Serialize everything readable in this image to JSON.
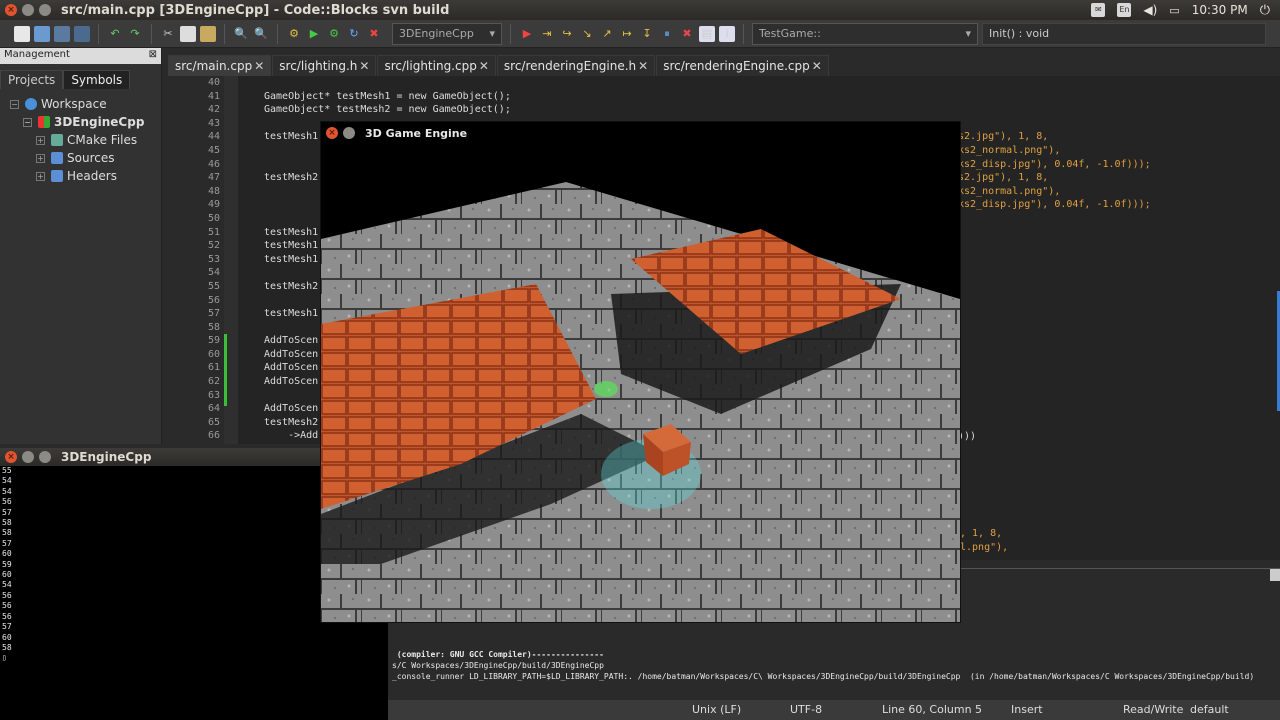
{
  "window": {
    "title": "src/main.cpp [3DEngineCpp] - Code::Blocks svn build"
  },
  "tray": {
    "lang": "En",
    "time": "10:30 PM"
  },
  "toolbar": {
    "build_target": "3DEngineCpp",
    "scope": "TestGame::",
    "function": "Init() : void"
  },
  "management": {
    "title": "Management",
    "tabs": [
      "Projects",
      "Symbols"
    ],
    "tree": {
      "workspace": "Workspace",
      "project": "3DEngineCpp",
      "folders": [
        "CMake Files",
        "Sources",
        "Headers"
      ]
    }
  },
  "editor": {
    "tabs": [
      "src/main.cpp",
      "src/lighting.h",
      "src/lighting.cpp",
      "src/renderingEngine.h",
      "src/renderingEngine.cpp"
    ],
    "line_numbers": [
      "40",
      "41",
      "42",
      "43",
      "44",
      "45",
      "46",
      "47",
      "48",
      "49",
      "50",
      "51",
      "52",
      "53",
      "54",
      "55",
      "56",
      "57",
      "58",
      "59",
      "60",
      "61",
      "62",
      "63",
      "64",
      "65",
      "66"
    ],
    "lines": [
      "",
      "GameObject* testMesh1 = new GameObject();",
      "GameObject* testMesh2 = new GameObject();",
      "",
      "testMesh1",
      "",
      "",
      "testMesh2",
      "",
      "",
      "",
      "testMesh1",
      "testMesh1",
      "testMesh1",
      "",
      "testMesh2",
      "",
      "testMesh1",
      "",
      "AddToScen",
      "AddToScen",
      "AddToScen",
      "AddToScen",
      "",
      "AddToScen",
      "testMesh2",
      "    ->Add"
    ],
    "right_fragments": [
      "s2.jpg\"), 1, 8,",
      "ks2_normal.png\"),",
      "ks2_disp.jpg\"), 0.04f, -1.0f)));",
      "s2.jpg\"), 1, 8,",
      "ks2_normal.png\"),",
      "ks2_disp.jpg\"), 0.04f, -1.0f)));",
      ")))"
    ],
    "lower_fragments": [
      ", 1, 8,",
      "l.png\"),"
    ]
  },
  "console": {
    "title": "3DEngineCpp",
    "output": [
      "55",
      "54",
      "54",
      "56",
      "57",
      "58",
      "58",
      "57",
      "60",
      "59",
      "60",
      "54",
      "56",
      "56",
      "56",
      "57",
      "60",
      "58",
      "▯"
    ]
  },
  "game": {
    "title": "3D Game Engine"
  },
  "logs": {
    "lines": [
      " (compiler: GNU GCC Compiler)---------------",
      "s/C Workspaces/3DEngineCpp/build/3DEngineCpp",
      "_console_runner LD_LIBRARY_PATH=$LD_LIBRARY_PATH:. /home/batman/Workspaces/C\\ Workspaces/3DEngineCpp/build/3DEngineCpp  (in /home/batman/Workspaces/C Workspaces/3DEngineCpp/build)"
    ]
  },
  "status": {
    "eol": "Unix (LF)",
    "encoding": "UTF-8",
    "position": "Line 60, Column 5",
    "mode": "Insert",
    "access": "Read/Write",
    "profile": "default"
  },
  "colors": {
    "brick": "#c4552b",
    "stone": "#8a8a8a",
    "accent_green": "#3bbf3b",
    "close_btn": "#e0542f"
  },
  "icons": [
    "close-icon",
    "minimize-icon",
    "maximize-icon",
    "keyboard-icon",
    "volume-icon",
    "power-icon",
    "workspace-icon",
    "project-icon",
    "folder-icon"
  ]
}
